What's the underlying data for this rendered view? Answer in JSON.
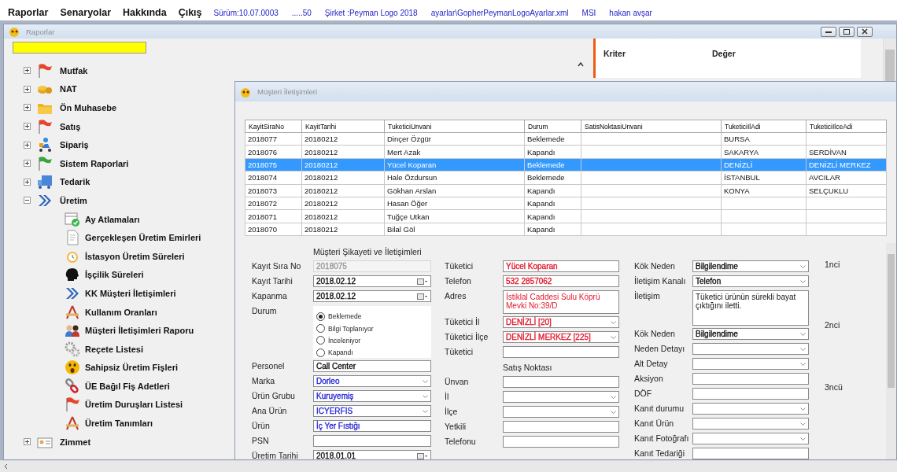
{
  "menu": {
    "items": [
      "Raporlar",
      "Senaryolar",
      "Hakkında",
      "Çıkış"
    ],
    "info": [
      "Sürüm:10.07.0003",
      ".....50",
      "Şirket :Peyman Logo 2018",
      "ayarlar\\GopherPeymanLogoAyarlar.xml",
      "MSI",
      "hakan avşar"
    ]
  },
  "reports_window": {
    "title": "Raporlar",
    "tree": [
      {
        "label": "Mutfak",
        "expanded": false
      },
      {
        "label": "NAT",
        "expanded": false
      },
      {
        "label": "Ön Muhasebe",
        "expanded": false
      },
      {
        "label": "Satış",
        "expanded": false
      },
      {
        "label": "Sipariş",
        "expanded": false
      },
      {
        "label": "Sistem Raporlari",
        "expanded": false
      },
      {
        "label": "Tedarik",
        "expanded": false
      },
      {
        "label": "Üretim",
        "expanded": true,
        "children": [
          {
            "label": "Ay Atlamaları"
          },
          {
            "label": "Gerçekleşen Üretim Emirleri"
          },
          {
            "label": "İstasyon Üretim Süreleri"
          },
          {
            "label": "İşçilik Süreleri"
          },
          {
            "label": "KK Müşteri İletişimleri"
          },
          {
            "label": "Kullanım Oranları"
          },
          {
            "label": "Müşteri İletişimleri Raporu"
          },
          {
            "label": "Reçete Listesi"
          },
          {
            "label": "Sahipsiz Üretim Fişleri"
          },
          {
            "label": "ÜE Bağıl Fiş Adetleri"
          },
          {
            "label": "Üretim Duruşları Listesi"
          },
          {
            "label": "Üretim Tanımları"
          }
        ]
      },
      {
        "label": "Zimmet",
        "expanded": false
      }
    ],
    "criteria_columns": [
      "Kriter",
      "Değer"
    ]
  },
  "contacts_window": {
    "title": "Müşteri İletişimleri",
    "grid": {
      "columns": [
        "KayitSiraNo",
        "KayitTarihi",
        "TuketiciUnvani",
        "Durum",
        "SatisNoktasiUnvani",
        "TuketiciIlAdi",
        "TuketiciIlceAdi"
      ],
      "rows": [
        {
          "selected": false,
          "cells": [
            "2018077",
            "20180212",
            "Dinçer Özgür",
            "Beklemede",
            null,
            "BURSA",
            null
          ]
        },
        {
          "selected": false,
          "cells": [
            "2018076",
            "20180212",
            "Mert Azak",
            "Kapandı",
            null,
            "SAKARYA",
            "SERDİVAN"
          ]
        },
        {
          "selected": true,
          "cells": [
            "2018075",
            "20180212",
            "Yücel Koparan",
            "Beklemede",
            null,
            "DENİZLİ",
            "DENİZLİ MERKEZ"
          ]
        },
        {
          "selected": false,
          "cells": [
            "2018074",
            "20180212",
            "Hale Özdursun",
            "Beklemede",
            null,
            "İSTANBUL",
            "AVCILAR"
          ]
        },
        {
          "selected": false,
          "cells": [
            "2018073",
            "20180212",
            "Gökhan Arslan",
            "Kapandı",
            null,
            "KONYA",
            "SELÇUKLU"
          ]
        },
        {
          "selected": false,
          "cells": [
            "2018072",
            "20180212",
            "Hasan Öğer",
            "Kapandı",
            null,
            null,
            null
          ]
        },
        {
          "selected": false,
          "cells": [
            "2018071",
            "20180212",
            "Tuğçe Utkan",
            "Kapandı",
            null,
            null,
            null
          ]
        },
        {
          "selected": false,
          "cells": [
            "2018070",
            "20180212",
            "Bilal Göl",
            "Kapandı",
            null,
            null,
            null
          ]
        }
      ]
    },
    "form_columns": [
      {
        "items": [
          {
            "kind": "heading",
            "label": "Müşteri Şikayeti ve İletişimleri"
          },
          {
            "kind": "text",
            "label": "Kayıt Sıra No",
            "value": "2018075",
            "disabled": true
          },
          {
            "kind": "date",
            "label": "Kayıt Tarihi",
            "value": "2018.02.12"
          },
          {
            "kind": "date",
            "label": "Kapanma",
            "value": "2018.02.12"
          },
          {
            "kind": "radio",
            "label": "Durum",
            "options": [
              {
                "label": "Beklemede",
                "selected": true
              },
              {
                "label": "Bilgi Toplanıyor",
                "selected": false
              },
              {
                "label": "İnceleniyor",
                "selected": false
              },
              {
                "label": "Kapandı",
                "selected": false
              }
            ]
          },
          {
            "kind": "text",
            "label": "Personel",
            "value": "Call Center"
          },
          {
            "kind": "combo",
            "label": "Marka",
            "value": "Dorleo",
            "color": "#2a2ad8"
          },
          {
            "kind": "combo",
            "label": "Ürün Grubu",
            "value": "Kuruyemiş",
            "color": "#2a2ad8"
          },
          {
            "kind": "combo",
            "label": "Ana Ürün",
            "value": "ICYERFIS",
            "color": "#2a2ad8"
          },
          {
            "kind": "text",
            "label": "Ürün",
            "value": "İç Yer Fıstığı",
            "color": "#2a2ad8"
          },
          {
            "kind": "text",
            "label": "PSN"
          },
          {
            "kind": "date",
            "label": "Üretim Tarihi",
            "value": "2018.01.01"
          }
        ]
      },
      {
        "items": [
          {
            "kind": "text",
            "label": "Tüketici",
            "value": "Yücel Koparan",
            "color": "#e0182c"
          },
          {
            "kind": "text",
            "label": "Telefon",
            "value": "532 2857062",
            "color": "#e0182c"
          },
          {
            "kind": "memo",
            "label": "Adres",
            "value": "İstiklal Caddesi Sulu Köprü Mevki No:39/D",
            "color": "#e0182c"
          },
          {
            "kind": "combo",
            "label": "Tüketici İl",
            "value": "DENİZLİ [20]",
            "color": "#e0182c"
          },
          {
            "kind": "combo",
            "label": "Tüketici İlçe",
            "value": "DENİZLİ MERKEZ [225]",
            "color": "#e0182c"
          },
          {
            "kind": "text",
            "label": "Tüketici"
          },
          {
            "kind": "heading",
            "label": "Satış Noktası"
          },
          {
            "kind": "text",
            "label": "Ünvan"
          },
          {
            "kind": "combo",
            "label": "İl"
          },
          {
            "kind": "combo",
            "label": "İlçe"
          },
          {
            "kind": "text",
            "label": "Yetkili"
          },
          {
            "kind": "text",
            "label": "Telefonu"
          }
        ]
      },
      {
        "items": [
          {
            "kind": "combo",
            "label": "Kök Neden",
            "value": "Bilgilendime"
          },
          {
            "kind": "combo",
            "label": "İletişim Kanalı",
            "value": "Telefon"
          },
          {
            "kind": "notes",
            "label": "İletişim",
            "value": "Tüketici ürünün sürekli bayat çıktığını iletti."
          },
          {
            "kind": "combo",
            "label": "Kök Neden",
            "value": "Bilgilendime"
          },
          {
            "kind": "combo",
            "label": "Neden Detayı"
          },
          {
            "kind": "combo",
            "label": "Alt Detay"
          },
          {
            "kind": "text",
            "label": "Aksiyon"
          },
          {
            "kind": "text",
            "label": "DÖF"
          },
          {
            "kind": "combo",
            "label": "Kanıt durumu"
          },
          {
            "kind": "combo",
            "label": "Kanıt Ürün"
          },
          {
            "kind": "combo",
            "label": "Kanıt Fotoğrafı"
          },
          {
            "kind": "text",
            "label": "Kanıt Tedariği"
          }
        ]
      }
    ],
    "sections": [
      "1nci",
      "2nci",
      "3ncü"
    ]
  }
}
